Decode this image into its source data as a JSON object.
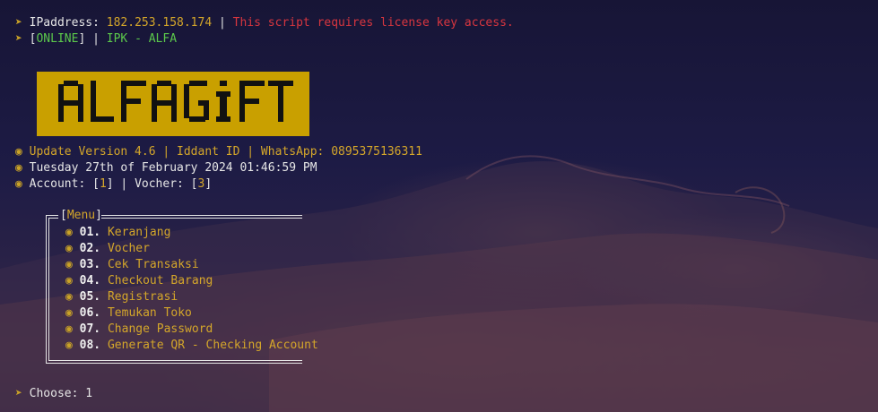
{
  "header": {
    "arrow": "➤",
    "ip_label": "IPaddress:",
    "ip_value": "182.253.158.174",
    "separator": "|",
    "license_msg": "This script requires license key access.",
    "status_open": "[",
    "status": "ONLINE",
    "status_close": "]",
    "app_name": "IPK - ALFA"
  },
  "logo": {
    "text": "ALFAGIFT",
    "bg_color": "#c9a000"
  },
  "info": {
    "bullet": "◉",
    "update_line": "Update Version 4.6 | Iddant ID | WhatsApp: 0895375136311",
    "date_line": "Tuesday 27th of February 2024 01:46:59 PM",
    "account_label": "Account: [",
    "account_count": "1",
    "account_mid": "] | Vocher: [",
    "vocher_count": "3",
    "account_end": "]"
  },
  "menu": {
    "title_open": "[",
    "title": "Menu",
    "title_close": "]",
    "items": [
      {
        "num": "01.",
        "label": "Keranjang"
      },
      {
        "num": "02.",
        "label": "Vocher"
      },
      {
        "num": "03.",
        "label": "Cek Transaksi"
      },
      {
        "num": "04.",
        "label": "Checkout Barang"
      },
      {
        "num": "05.",
        "label": "Registrasi"
      },
      {
        "num": "06.",
        "label": "Temukan Toko"
      },
      {
        "num": "07.",
        "label": "Change Password"
      },
      {
        "num": "08.",
        "label": "Generate QR - Checking Account"
      }
    ]
  },
  "prompt": {
    "arrow": "➤",
    "label": "Choose:",
    "value": "1"
  },
  "colors": {
    "accent": "#d4a62a",
    "online": "#5bc84b",
    "error": "#d8363f"
  }
}
